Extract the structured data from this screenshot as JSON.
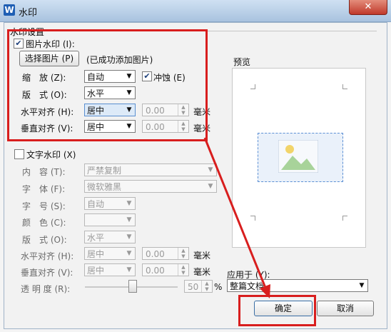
{
  "window": {
    "title": "水印",
    "app_icon": "W",
    "close": "✕"
  },
  "group": {
    "title": "水印设置"
  },
  "picture_wm": {
    "checkbox_label": "图片水印 (I):",
    "checked": true,
    "select_button": "选择图片 (P)",
    "status": "(已成功添加图片)",
    "scale_label": "缩　放 (Z):",
    "scale_value": "自动",
    "washout_label": "冲蚀 (E)",
    "washout_checked": true,
    "layout_label": "版　式 (O):",
    "layout_value": "水平",
    "halign_label": "水平对齐 (H):",
    "halign_value": "居中",
    "halign_num": "0.00",
    "halign_unit": "毫米",
    "valign_label": "垂直对齐 (V):",
    "valign_value": "居中",
    "valign_num": "0.00",
    "valign_unit": "毫米"
  },
  "text_wm": {
    "checkbox_label": "文字水印 (X)",
    "checked": false,
    "content_label": "内　容 (T):",
    "content_value": "严禁复制",
    "font_label": "字　体 (F):",
    "font_value": "微软雅黑",
    "size_label": "字　号 (S):",
    "size_value": "自动",
    "color_label": "颜　色 (C):",
    "color_value": "",
    "layout_label": "版　式 (O):",
    "layout_value": "水平",
    "halign_label": "水平对齐 (H):",
    "halign_value": "居中",
    "halign_num": "0.00",
    "halign_unit": "毫米",
    "valign_label": "垂直对齐 (V):",
    "valign_value": "居中",
    "valign_num": "0.00",
    "valign_unit": "毫米",
    "transparency_label": "透 明 度 (R):",
    "transparency_value": "50",
    "transparency_unit": "%"
  },
  "preview": {
    "label": "预览"
  },
  "apply": {
    "label": "应用于 (Y):",
    "value": "整篇文档"
  },
  "buttons": {
    "ok": "确定",
    "cancel": "取消"
  },
  "colors": {
    "annotation_red": "#d81e1e",
    "title_bar": "#a9c3df"
  }
}
